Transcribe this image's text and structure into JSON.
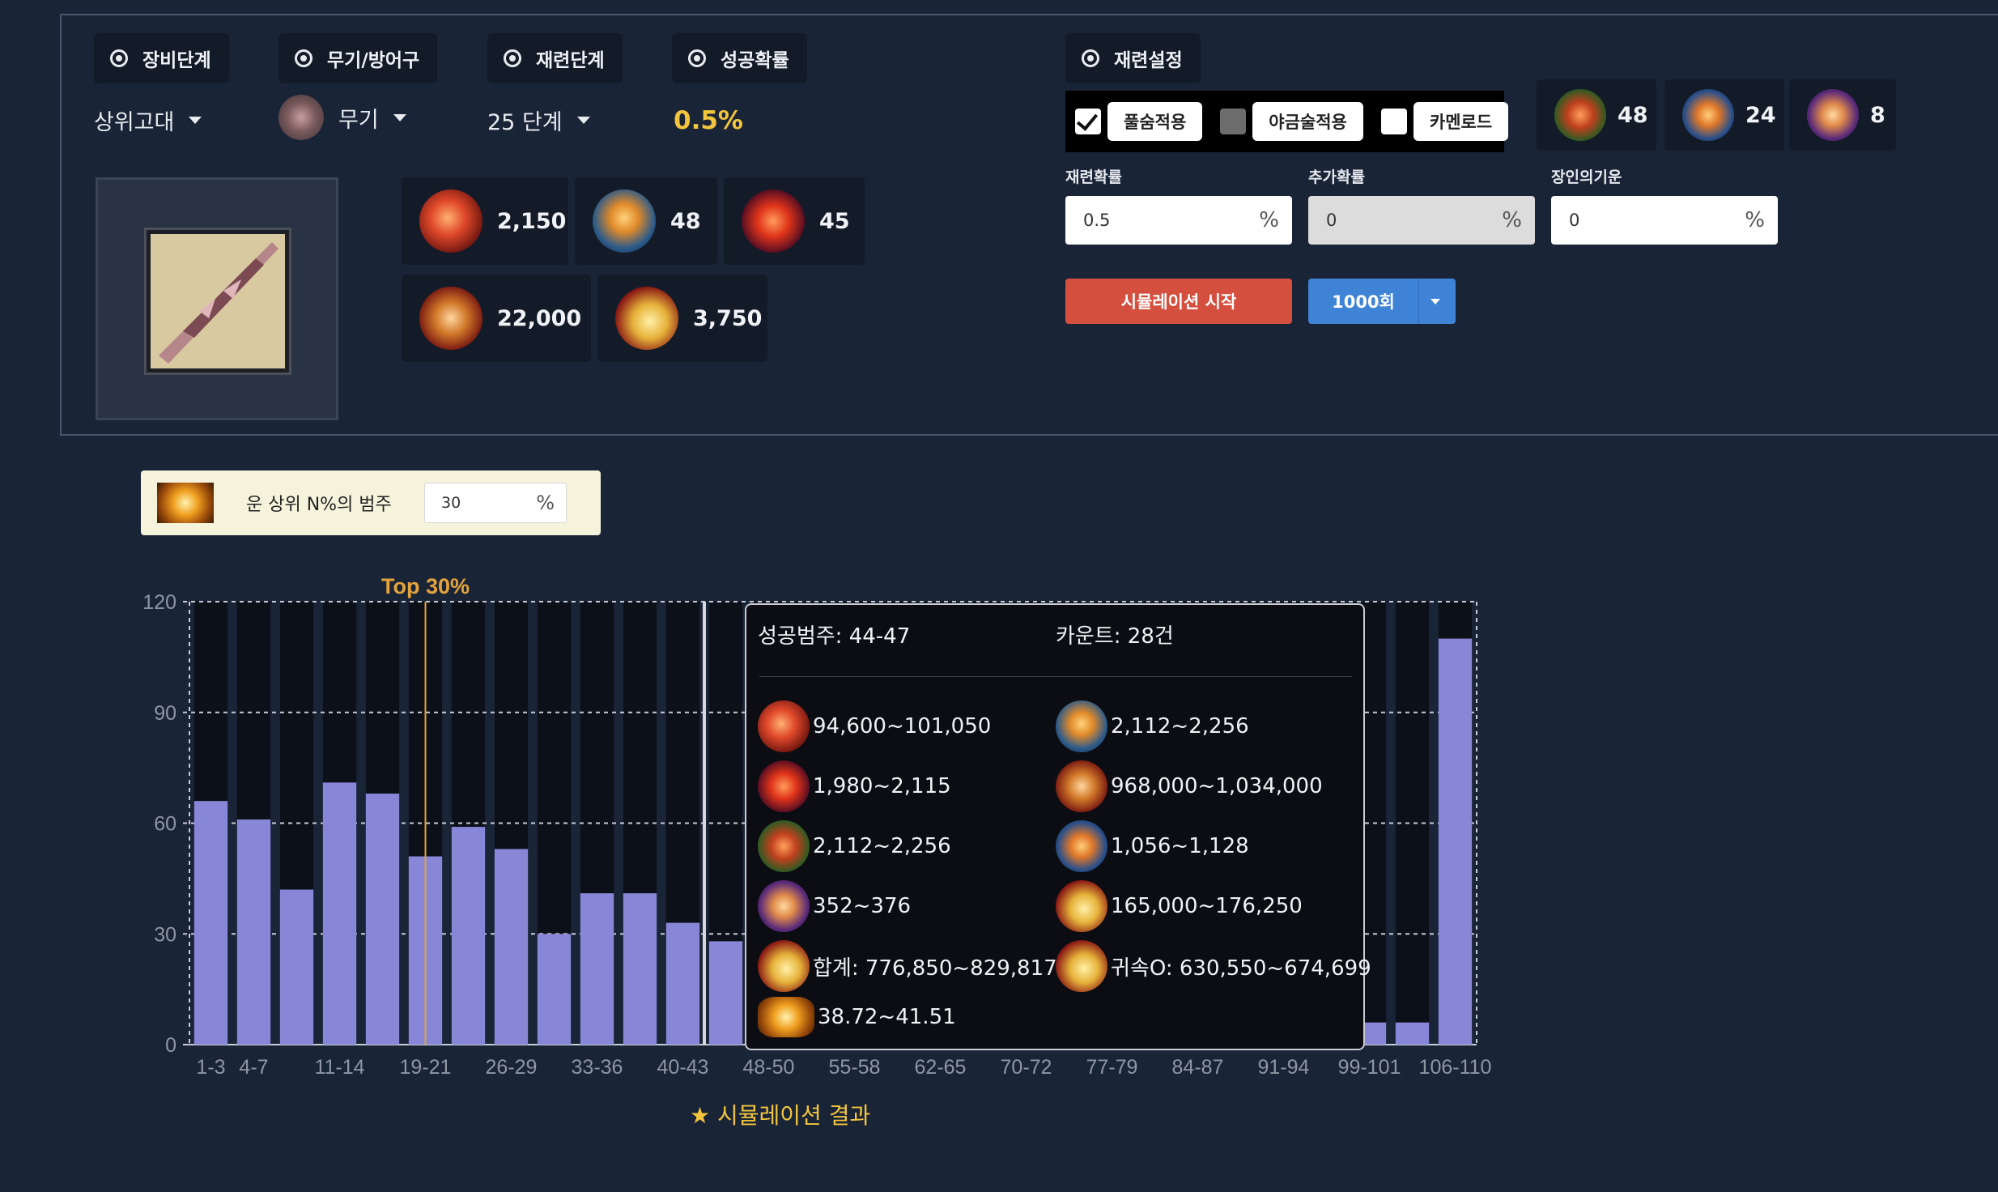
{
  "top": {
    "chips": {
      "equip_stage": "장비단계",
      "weapon_armor": "무기/방어구",
      "refine_stage": "재련단계",
      "success_rate": "성공확률",
      "refine_settings": "재련설정"
    },
    "dropdowns": {
      "equip_stage_value": "상위고대",
      "weapon_armor_value": "무기",
      "refine_stage_value": "25 단계"
    },
    "success_rate_value": "0.5%",
    "materials": [
      {
        "icon": "destruction-stone-icon",
        "value": "2,150"
      },
      {
        "icon": "leapstone-icon",
        "value": "48"
      },
      {
        "icon": "fusion-material-icon",
        "value": "45"
      },
      {
        "icon": "shard-icon",
        "value": "22,000"
      },
      {
        "icon": "gold-icon",
        "value": "3,750"
      }
    ],
    "options": {
      "breath_label": "풀숨적용",
      "metallurgy_label": "야금술적용",
      "karmen_label": "카멘로드"
    },
    "extra_materials": [
      {
        "icon": "breath-icon",
        "value": "48"
      },
      {
        "icon": "book-icon",
        "value": "24"
      },
      {
        "icon": "gem-icon",
        "value": "8"
      }
    ],
    "fields": {
      "refine_prob_label": "재련확률",
      "refine_prob_value": "0.5",
      "extra_prob_label": "추가확률",
      "extra_prob_value": "0",
      "artisan_label": "장인의기운",
      "artisan_value": "0",
      "percent": "%"
    },
    "start_button": "시뮬레이션 시작",
    "count_button": "1000회"
  },
  "luck": {
    "label": "운 상위 N%의 범주",
    "value": "30",
    "percent": "%"
  },
  "colors": {
    "bar": "#8886d6",
    "bar_bg": "#0c1018",
    "marker": "#e3a33c",
    "accent": "#f2c53d"
  },
  "chart_data": {
    "type": "bar",
    "title": "",
    "xlabel": "",
    "ylabel": "",
    "ylim": [
      0,
      120
    ],
    "y_ticks": [
      "0",
      "30",
      "60",
      "90",
      "120"
    ],
    "categories": [
      "1-3",
      "4-7",
      "8-10",
      "11-14",
      "15-18",
      "19-21",
      "22-25",
      "26-29",
      "30-32",
      "33-36",
      "37-40",
      "40-43",
      "44-47",
      "48-50",
      "51-54",
      "55-58",
      "59-61",
      "62-65",
      "66-69",
      "70-72",
      "73-76",
      "77-79",
      "80-83",
      "84-87",
      "88-90",
      "91-94",
      "95-98",
      "99-101",
      "102-105",
      "106-110"
    ],
    "x_tick_labels": [
      "1-3",
      "4-7",
      "",
      "11-14",
      "",
      "19-21",
      "",
      "26-29",
      "",
      "33-36",
      "",
      "40-43",
      "",
      "48-50",
      "",
      "55-58",
      "",
      "62-65",
      "",
      "70-72",
      "",
      "77-79",
      "",
      "84-87",
      "",
      "91-94",
      "",
      "99-101",
      "",
      "106-110"
    ],
    "values": [
      66,
      61,
      42,
      71,
      68,
      51,
      59,
      53,
      30,
      41,
      41,
      33,
      28,
      null,
      null,
      null,
      null,
      null,
      null,
      null,
      null,
      null,
      null,
      null,
      null,
      null,
      null,
      6,
      6,
      110
    ],
    "marker": {
      "label": "Top 30%",
      "category": "19-21"
    },
    "hover_category": "44-47"
  },
  "tooltip": {
    "range": "성공범주: 44-47",
    "count": "카운트: 28건",
    "rows": [
      {
        "icon": "destruction-stone-icon",
        "text": "94,600~101,050"
      },
      {
        "icon": "leapstone-icon",
        "text": "2,112~2,256"
      },
      {
        "icon": "fusion-material-icon",
        "text": "1,980~2,115"
      },
      {
        "icon": "shard-icon",
        "text": "968,000~1,034,000"
      },
      {
        "icon": "breath-icon",
        "text": "2,112~2,256"
      },
      {
        "icon": "book-icon",
        "text": "1,056~1,128"
      },
      {
        "icon": "gem-icon",
        "text": "352~376"
      },
      {
        "icon": "gold-icon",
        "text": "165,000~176,250"
      },
      {
        "icon": "gold-icon",
        "text": "합계: 776,850~829,817"
      },
      {
        "icon": "gold-icon",
        "text": "귀속O: 630,550~674,699"
      },
      {
        "icon": "ingot-icon",
        "text": "38.72~41.51"
      }
    ]
  },
  "caption": "★ 시뮬레이션 결과"
}
